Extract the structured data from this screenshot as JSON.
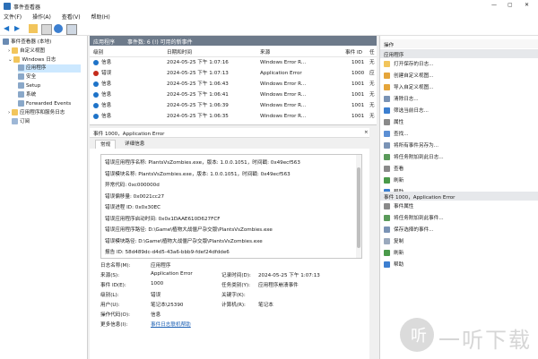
{
  "window": {
    "title": "事件查看器"
  },
  "menu": [
    "文件(F)",
    "操作(A)",
    "查看(V)",
    "帮助(H)"
  ],
  "tree": [
    {
      "label": "事件查看器 (本地)",
      "level": 0
    },
    {
      "label": "自定义视图",
      "level": 1
    },
    {
      "label": "Windows 日志",
      "level": 1
    },
    {
      "label": "应用程序",
      "level": 2,
      "selected": true
    },
    {
      "label": "安全",
      "level": 2
    },
    {
      "label": "Setup",
      "level": 2
    },
    {
      "label": "系统",
      "level": 2
    },
    {
      "label": "Forwarded Events",
      "level": 2
    },
    {
      "label": "应用程序和服务日志",
      "level": 1
    },
    {
      "label": "订阅",
      "level": 1
    }
  ],
  "list": {
    "log_name": "应用程序",
    "count_text": "事件数: 6 (!) 可用的新事件",
    "columns": [
      "级别",
      "日期和时间",
      "来源",
      "事件 ID",
      "任"
    ],
    "rows": [
      {
        "level": "信息",
        "time": "2024-05-25 下午 1:07:16",
        "source": "Windows Error R...",
        "id": "1001",
        "task": "无"
      },
      {
        "level": "错误",
        "time": "2024-05-25 下午 1:07:13",
        "source": "Application Error",
        "id": "1000",
        "task": "应"
      },
      {
        "level": "信息",
        "time": "2024-05-25 下午 1:06:43",
        "source": "Windows Error R...",
        "id": "1001",
        "task": "无"
      },
      {
        "level": "信息",
        "time": "2024-05-25 下午 1:06:41",
        "source": "Windows Error R...",
        "id": "1001",
        "task": "无"
      },
      {
        "level": "信息",
        "time": "2024-05-25 下午 1:06:39",
        "source": "Windows Error R...",
        "id": "1001",
        "task": "无"
      },
      {
        "level": "信息",
        "time": "2024-05-25 下午 1:06:35",
        "source": "Windows Error R...",
        "id": "1001",
        "task": "无"
      }
    ]
  },
  "detail": {
    "header": "事件 1000，Application Error",
    "close": "×",
    "tabs": [
      "常规",
      "详细信息"
    ],
    "message_lines": [
      "错误应用程序名称: PlantsVsZombies.exe，版本: 1.0.0.1051，时间戳: 0x49ecf563",
      "错误模块名称: PlantsVsZombies.exe，版本: 1.0.0.1051，时间戳: 0x49ecf563",
      "异常代码: 0xc000000d",
      "错误偏移量: 0x0021cc27",
      "错误进程 ID: 0x0x30EC",
      "错误应用程序启动时间: 0x0x1DAAE610D627FCF",
      "错误应用程序路径: D:\\Game\\植物大战僵尸杂交版\\PlantsVsZombies.exe",
      "错误模块路径: D:\\Game\\植物大战僵尸杂交版\\PlantsVsZombies.exe",
      "报告 ID: 58d489dc-d4d5-43a6-bbb9-fdef24dfdde6"
    ],
    "fields": {
      "log_name_label": "日志名称(M):",
      "log_name": "应用程序",
      "source_label": "来源(S):",
      "source": "Application Error",
      "recorded_label": "记录时间(D):",
      "recorded": "2024-05-25 下午 1:07:13",
      "event_id_label": "事件 ID(E):",
      "event_id": "1000",
      "task_label": "任务类别(Y):",
      "task": "应用程序崩溃事件",
      "level_label": "级别(L):",
      "level": "错误",
      "keywords_label": "关键字(K):",
      "keywords": "",
      "user_label": "用户(U):",
      "user": "笔记本\\25390",
      "computer_label": "计算机(R):",
      "computer": "笔记本",
      "opcode_label": "操作代码(O):",
      "opcode": "信息",
      "more_label": "更多信息(I):",
      "more_link": "事件日志联机帮助"
    }
  },
  "actions": {
    "section1": "应用程序",
    "items1": [
      "打开保存的日志...",
      "创建自定义视图...",
      "导入自定义视图...",
      "清除日志...",
      "筛选当前日志...",
      "属性",
      "查找...",
      "将所有事件另存为...",
      "将任务附加到此日志...",
      "查看",
      "刷新",
      "帮助"
    ],
    "section2": "事件 1000，Application Error",
    "items2": [
      "事件属性",
      "将任务附加到此事件...",
      "保存选择的事件...",
      "复制",
      "刷新",
      "帮助"
    ]
  },
  "watermark": "一听下载",
  "colors": {
    "accent": "#1e73c8",
    "header": "#6d7a8a",
    "selected": "#cce8ff"
  }
}
